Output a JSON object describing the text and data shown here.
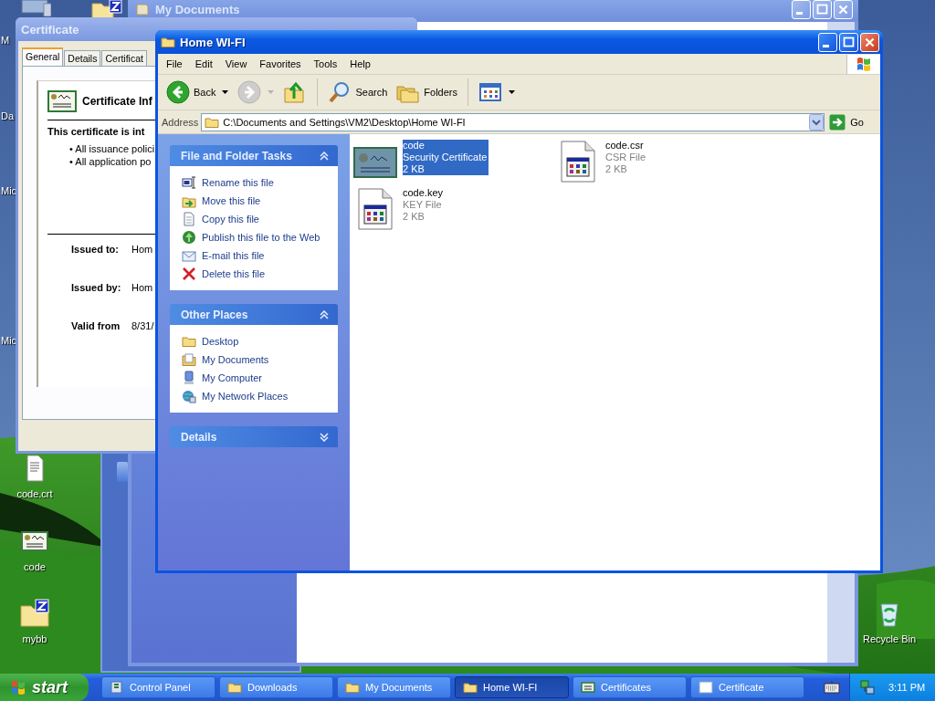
{
  "desktop": {
    "cut_labels": [
      "M",
      "Da",
      "Mic",
      "Mic"
    ],
    "icons": [
      {
        "label": "code.crt",
        "kind": "document"
      },
      {
        "label": "code",
        "kind": "certificate"
      },
      {
        "label": "mybb",
        "kind": "zip-folder"
      },
      {
        "label": "Recycle Bin",
        "kind": "recycle-bin"
      }
    ]
  },
  "background_window": {
    "title": "My Documents"
  },
  "certificate_window": {
    "title": "Certificate",
    "tabs": [
      {
        "label": "General",
        "selected": true
      },
      {
        "label": "Details",
        "selected": false
      },
      {
        "label": "Certificat",
        "selected": false
      }
    ],
    "heading": "Certificate Inf",
    "purpose": "This certificate is int",
    "bullets": [
      "• All issuance polici",
      "• All application po"
    ],
    "fields": [
      {
        "label": "Issued to:",
        "value": "Hom"
      },
      {
        "label": "Issued by:",
        "value": "Hom"
      },
      {
        "label": "Valid from",
        "value": "8/31/"
      }
    ]
  },
  "explorer": {
    "title": "Home WI-FI",
    "menu": [
      "File",
      "Edit",
      "View",
      "Favorites",
      "Tools",
      "Help"
    ],
    "toolbar": [
      {
        "kind": "back",
        "label": "Back",
        "disabled": false
      },
      {
        "kind": "forward",
        "disabled": true
      },
      {
        "kind": "up",
        "disabled": false
      },
      {
        "kind": "search",
        "label": "Search",
        "disabled": false
      },
      {
        "kind": "folders",
        "label": "Folders",
        "disabled": false
      },
      {
        "kind": "views",
        "disabled": false
      }
    ],
    "address": {
      "label": "Address",
      "value": "C:\\Documents and Settings\\VM2\\Desktop\\Home WI-FI",
      "go": "Go"
    },
    "panels": [
      {
        "title": "File and Folder Tasks",
        "expanded": true,
        "items": [
          {
            "label": "Rename this file",
            "kind": "rename"
          },
          {
            "label": "Move this file",
            "kind": "move"
          },
          {
            "label": "Copy this file",
            "kind": "copy"
          },
          {
            "label": "Publish this file to the Web",
            "kind": "publish"
          },
          {
            "label": "E-mail this file",
            "kind": "email"
          },
          {
            "label": "Delete this file",
            "kind": "delete"
          }
        ]
      },
      {
        "title": "Other Places",
        "expanded": true,
        "items": [
          {
            "label": "Desktop",
            "kind": "folder"
          },
          {
            "label": "My Documents",
            "kind": "documents"
          },
          {
            "label": "My Computer",
            "kind": "computer"
          },
          {
            "label": "My Network Places",
            "kind": "network"
          }
        ]
      },
      {
        "title": "Details",
        "expanded": false
      }
    ],
    "files": [
      {
        "name": "code",
        "type": "Security Certificate",
        "size": "2 KB",
        "kind": "certificate",
        "selected": true
      },
      {
        "name": "code.csr",
        "type": "CSR File",
        "size": "2 KB",
        "kind": "document",
        "selected": false
      },
      {
        "name": "code.key",
        "type": "KEY File",
        "size": "2 KB",
        "kind": "document",
        "selected": false
      }
    ]
  },
  "taskbar": {
    "start": "start",
    "tasks": [
      {
        "label": "Control Panel",
        "kind": "control-panel",
        "selected": false
      },
      {
        "label": "Downloads",
        "kind": "folder",
        "selected": false
      },
      {
        "label": "My Documents",
        "kind": "folder",
        "selected": false
      },
      {
        "label": "Home WI-FI",
        "kind": "folder",
        "selected": true
      },
      {
        "label": "Certificates",
        "kind": "certificates",
        "selected": false
      },
      {
        "label": "Certificate",
        "kind": "window",
        "selected": false
      }
    ],
    "clock": "3:11 PM"
  }
}
